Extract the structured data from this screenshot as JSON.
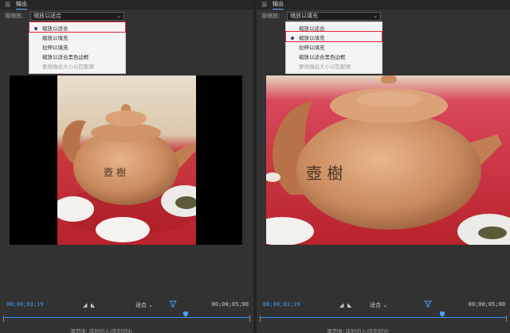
{
  "panels": [
    {
      "tabs": {
        "source": "源",
        "output": "输出"
      },
      "scaling": {
        "label": "源缩放:",
        "selected": "缩放以适合"
      },
      "menu": {
        "options": [
          "缩放以适合",
          "缩放以填充",
          "拉伸以填充",
          "缩放以适合黑色边框",
          "更改输出大小以匹配源"
        ],
        "checked_index": 0
      },
      "controls": {
        "current_time": "00;00;03;19",
        "zoom": "适合",
        "duration": "00;00;05;00"
      },
      "footer": "源范围:  序列切入/序列切出"
    },
    {
      "tabs": {
        "source": "源",
        "output": "输出"
      },
      "scaling": {
        "label": "源缩放:",
        "selected": "缩放以填充"
      },
      "menu": {
        "options": [
          "缩放以适合",
          "缩放以填充",
          "拉伸以填充",
          "缩放以适合黑色边框",
          "更改输出大小以匹配源"
        ],
        "checked_index": 1
      },
      "controls": {
        "current_time": "00;00;03;19",
        "zoom": "适合",
        "duration": "00;00;05;00"
      },
      "footer": "源范围:  序列切入/序列切出"
    }
  ],
  "colors": {
    "highlight": "#e0243a",
    "timecode": "#4a9cff",
    "accent": "#3a8dff"
  }
}
